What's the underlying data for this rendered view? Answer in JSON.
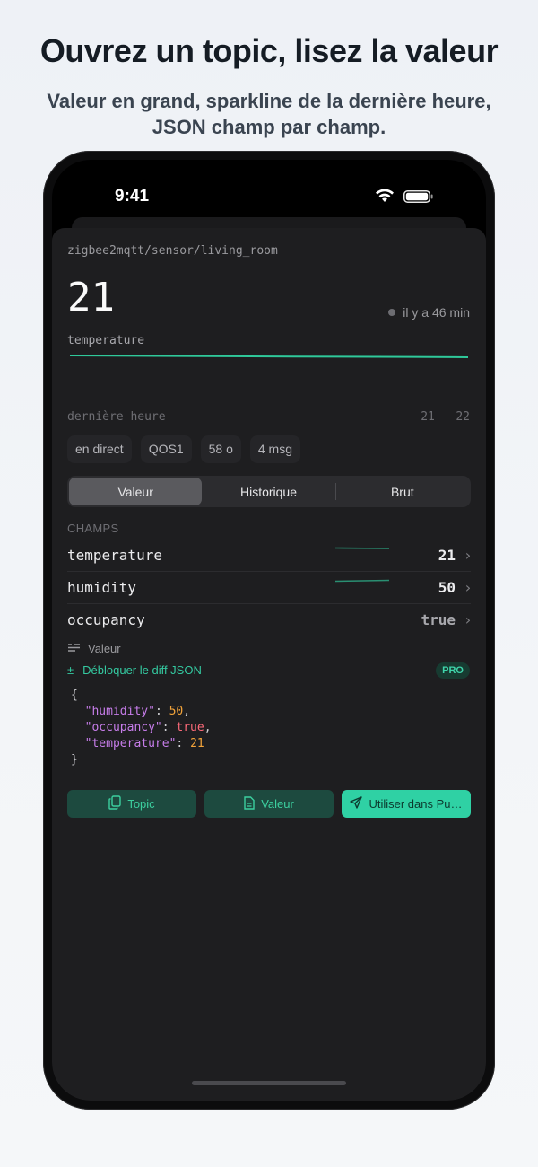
{
  "header": {
    "title": "Ouvrez un topic, lisez la valeur",
    "subtitle": "Valeur en grand, sparkline de la dernière heure, JSON champ par champ."
  },
  "status_bar": {
    "time": "9:41"
  },
  "topic": {
    "path": "zigbee2mqtt/sensor/living_room",
    "big_value": "21",
    "ago": "il y a 46 min",
    "field": "temperature"
  },
  "stats": {
    "window_label": "dernière heure",
    "range": "21 — 22",
    "chips": [
      "en direct",
      "QOS1",
      "58 o",
      "4 msg"
    ]
  },
  "tabs": [
    "Valeur",
    "Historique",
    "Brut"
  ],
  "fields_section": {
    "title": "CHAMPS",
    "rows": [
      {
        "name": "temperature",
        "value": "21"
      },
      {
        "name": "humidity",
        "value": "50"
      },
      {
        "name": "occupancy",
        "value": "true"
      }
    ]
  },
  "json_section": {
    "label": "Valeur",
    "unlock": "Débloquer le diff JSON",
    "badge": "PRO",
    "brace_open": "{",
    "brace_close": "}",
    "lines": [
      {
        "key": "\"humidity\"",
        "sep": ": ",
        "value": "50",
        "kind": "num",
        "trail": ","
      },
      {
        "key": "\"occupancy\"",
        "sep": ": ",
        "value": "true",
        "kind": "bool",
        "trail": ","
      },
      {
        "key": "\"temperature\"",
        "sep": ": ",
        "value": "21",
        "kind": "num",
        "trail": ""
      }
    ]
  },
  "actions": {
    "topic": "Topic",
    "valeur": "Valeur",
    "publish": "Utiliser dans Pu…"
  },
  "colors": {
    "accent": "#2fd1a4",
    "sheet": "#1e1e20",
    "json_key": "#c77dea",
    "json_number": "#f2a33a",
    "json_bool": "#ff6b7a"
  },
  "icons": [
    "wifi-icon",
    "battery-icon",
    "status-dot-icon",
    "chevron-right-icon",
    "text-lines-icon",
    "plus-minus-icon",
    "copy-icon",
    "document-icon",
    "send-icon"
  ]
}
